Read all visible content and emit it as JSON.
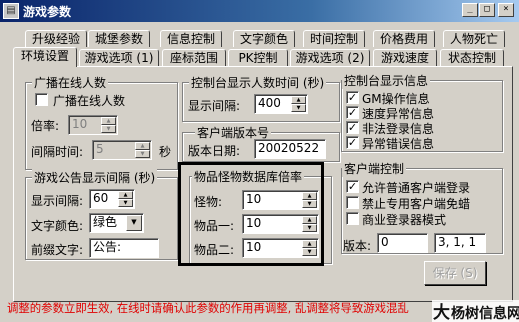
{
  "window": {
    "title": "游戏参数",
    "minimize_glyph": "_",
    "maximize_glyph": "□",
    "close_glyph": "×"
  },
  "tabs_back": [
    "升级经验",
    "城堡参数",
    "信息控制",
    "文字颜色",
    "时间控制",
    "价格费用",
    "人物死亡"
  ],
  "tabs_front": [
    "环境设置",
    "游戏选项 (1)",
    "座标范围",
    "PK控制",
    "游戏选项 (2)",
    "游戏速度",
    "状态控制"
  ],
  "active_tab": "环境设置",
  "online_group": {
    "title": "广播在线人数",
    "checkbox_label": "广播在线人数",
    "checked": false,
    "rate_label": "倍率:",
    "rate_value": "10",
    "interval_label": "间隔时间:",
    "interval_value": "5",
    "interval_unit": "秒"
  },
  "console_count_group": {
    "title": "控制台显示人数时间 (秒)",
    "interval_label": "显示间隔:",
    "interval_value": "400"
  },
  "client_version_group": {
    "title": "客户端版本号",
    "date_label": "版本日期:",
    "date_value": "20020522"
  },
  "console_info_group": {
    "title": "控制台显示信息",
    "items": [
      {
        "label": "GM操作信息",
        "checked": true
      },
      {
        "label": "速度异常信息",
        "checked": true
      },
      {
        "label": "非法登录信息",
        "checked": true
      },
      {
        "label": "异常错误信息",
        "checked": true
      }
    ]
  },
  "announce_group": {
    "title": "游戏公告显示间隔 (秒)",
    "interval_label": "显示间隔:",
    "interval_value": "60",
    "color_label": "文字颜色:",
    "color_value": "绿色",
    "prefix_label": "前缀文字:",
    "prefix_value": "公告:"
  },
  "drop_rate_group": {
    "title": "物品怪物数据库倍率",
    "rows": [
      {
        "label": "怪物:",
        "value": "10"
      },
      {
        "label": "物品一:",
        "value": "10"
      },
      {
        "label": "物品二:",
        "value": "10"
      }
    ]
  },
  "client_control_group": {
    "title": "客户端控制",
    "items": [
      {
        "label": "允许普通客户端登录",
        "checked": true
      },
      {
        "label": "禁止专用客户端免蜡",
        "checked": false
      },
      {
        "label": "商业登录器模式",
        "checked": false
      }
    ],
    "version_label": "版本:",
    "version_value": "0",
    "version_value2": "3, 1, 1"
  },
  "save_button": "保存 (S)",
  "notice": "调整的参数立即生效, 在线时请确认此参数的作用再调整, 乱调整将导致游戏混乱",
  "watermark": "大杨树信息网",
  "colors": {
    "title_bar_start": "#0a246a",
    "title_bar_end": "#a6caf0",
    "face": "#d4d0c8",
    "notice_red": "#e00000"
  }
}
